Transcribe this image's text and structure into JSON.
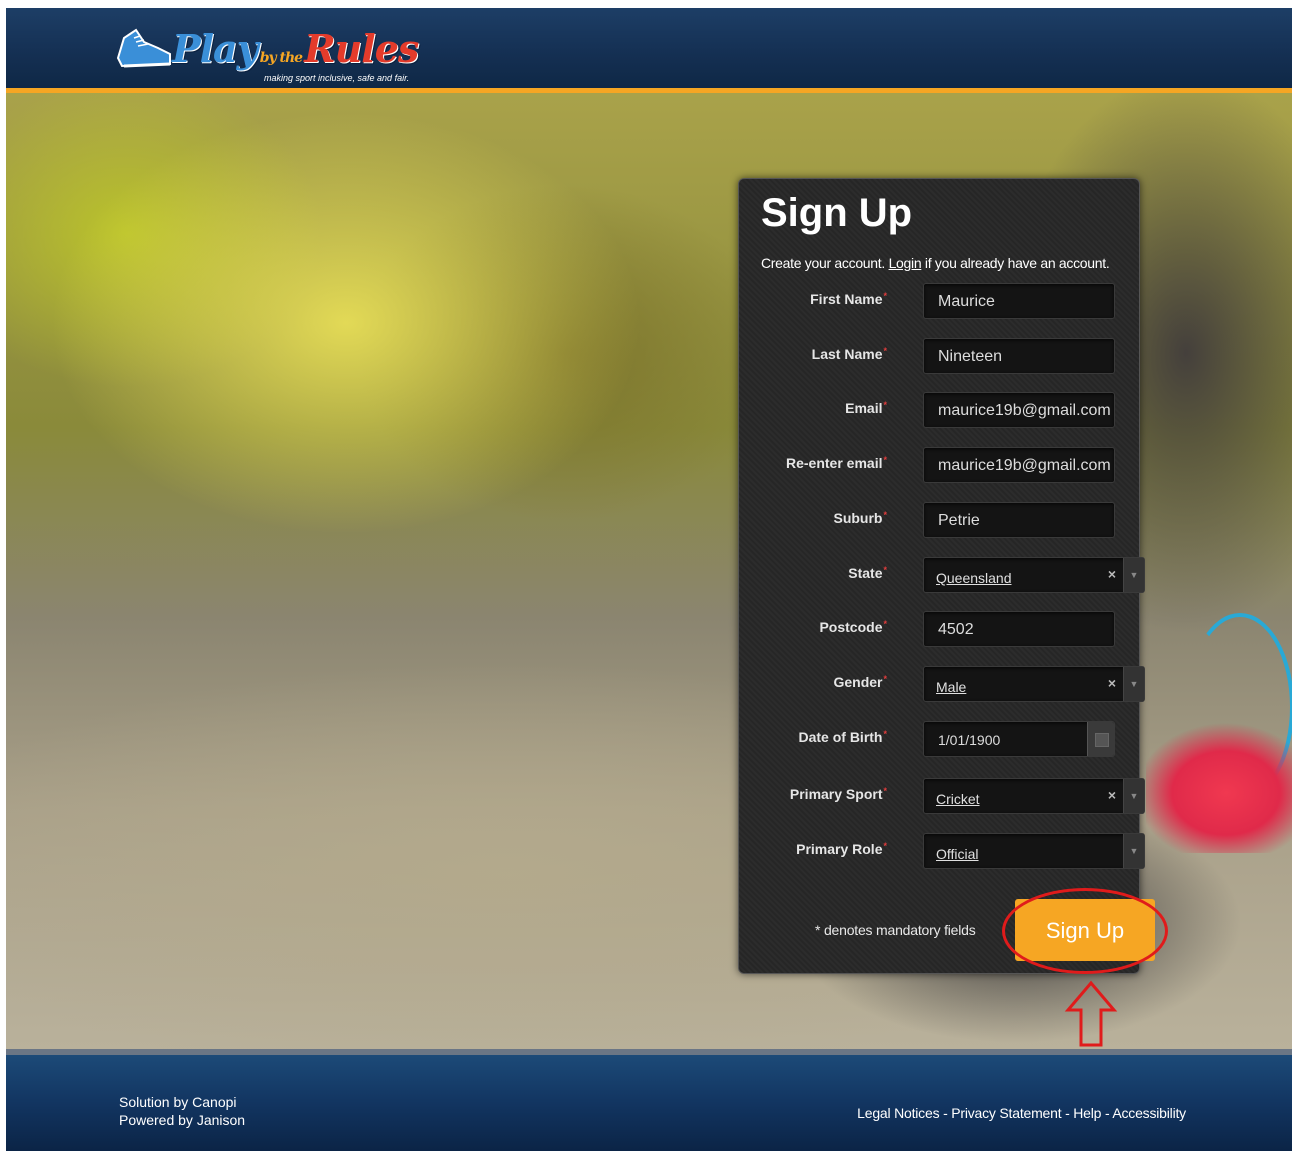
{
  "brand": {
    "logo_play": "Play",
    "logo_by": "by the",
    "logo_rules": "Rules",
    "tagline": "making sport inclusive, safe and fair."
  },
  "form": {
    "title": "Sign Up",
    "intro_prefix": "Create your account.",
    "login_link": "Login",
    "intro_suffix": "if you already have an account.",
    "required_marker": "*",
    "fields": {
      "first_name": {
        "label": "First Name",
        "value": "Maurice"
      },
      "last_name": {
        "label": "Last Name",
        "value": "Nineteen"
      },
      "email": {
        "label": "Email",
        "value": "maurice19b@gmail.com"
      },
      "reenter_email": {
        "label": "Re-enter email",
        "value": "maurice19b@gmail.com"
      },
      "suburb": {
        "label": "Suburb",
        "value": "Petrie"
      },
      "state": {
        "label": "State",
        "value": "Queensland"
      },
      "postcode": {
        "label": "Postcode",
        "value": "4502"
      },
      "gender": {
        "label": "Gender",
        "value": "Male"
      },
      "dob": {
        "label": "Date of Birth",
        "value": "1/01/1900"
      },
      "primary_sport": {
        "label": "Primary Sport",
        "value": "Cricket"
      },
      "primary_role": {
        "label": "Primary Role",
        "value": "Official"
      }
    },
    "clear_glyph": "×",
    "arrow_glyph": "▼",
    "mandatory_note": "* denotes mandatory fields",
    "submit_label": "Sign Up"
  },
  "footer": {
    "solution_by": "Solution by Canopi",
    "powered_by": "Powered by Janison",
    "links": [
      "Legal Notices",
      "Privacy Statement",
      "Help",
      "Accessibility"
    ],
    "separator": " - "
  },
  "colors": {
    "accent": "#f6a623",
    "header_blue": "#1d3e66",
    "highlight_red": "#e01b1b"
  },
  "icons": [
    "shoe-logo-icon",
    "calendar-icon",
    "clear-icon",
    "dropdown-arrow-icon",
    "up-arrow-annotation-icon"
  ]
}
